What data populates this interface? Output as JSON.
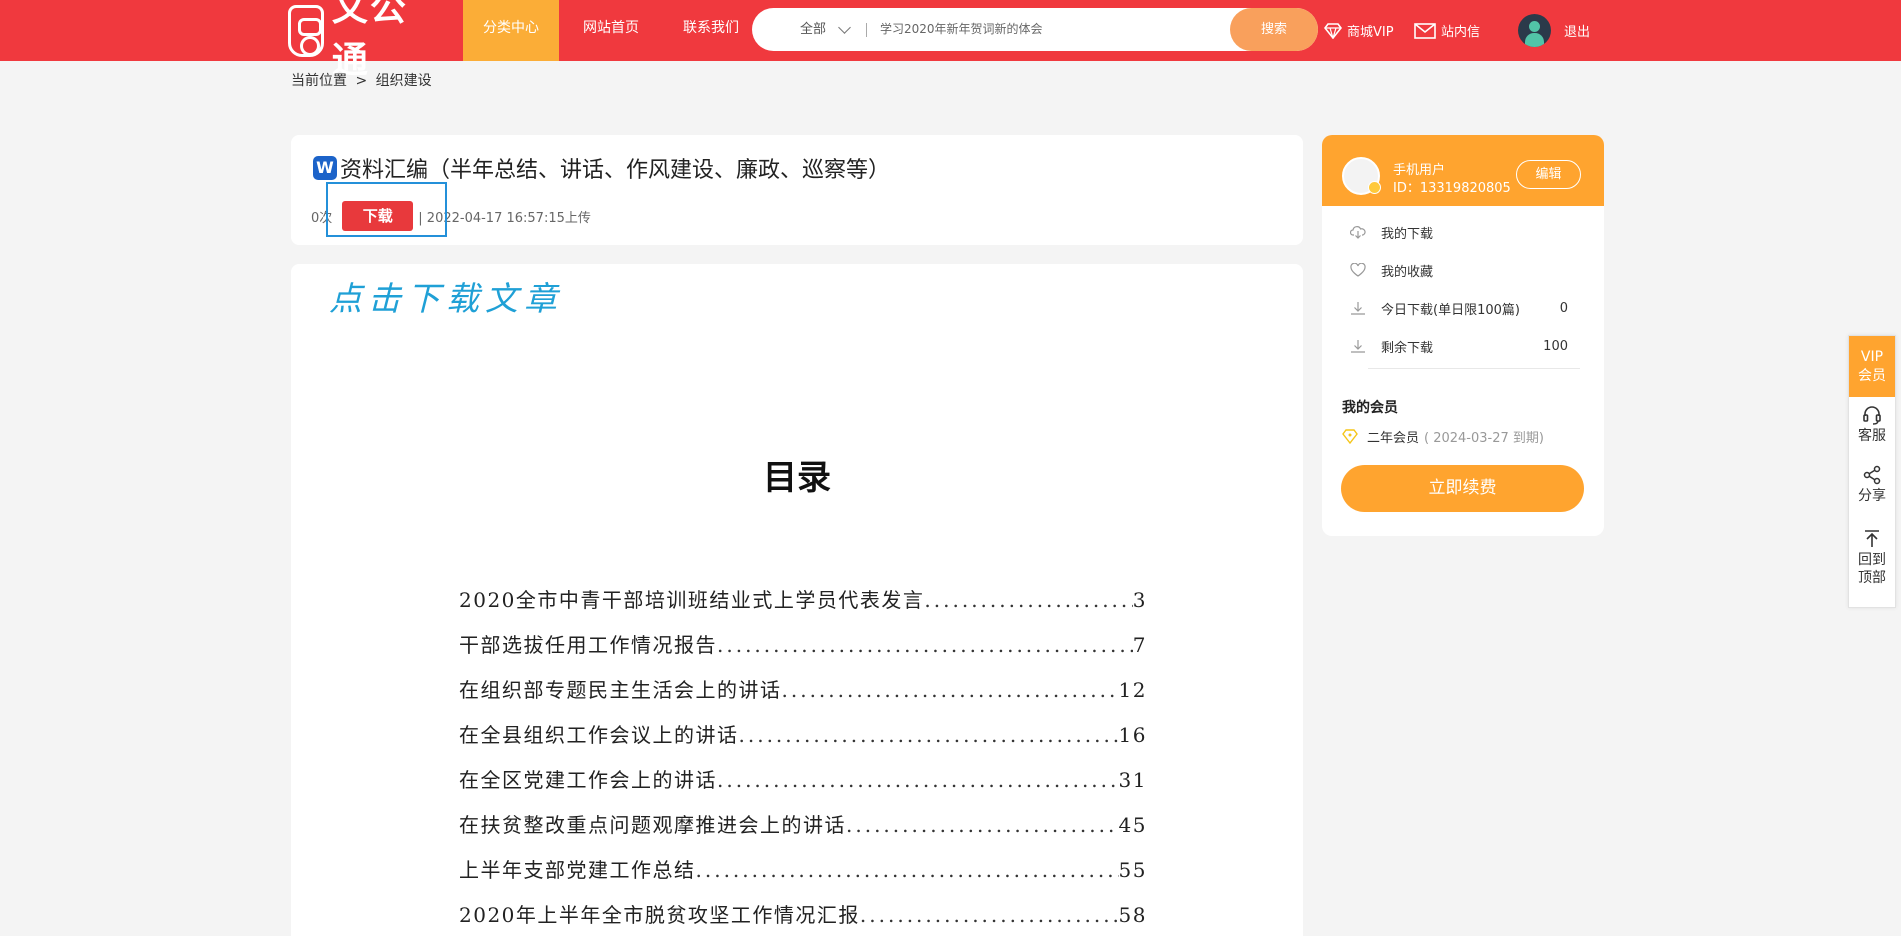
{
  "header": {
    "logo_text": "文公通",
    "nav": [
      "分类中心",
      "网站首页",
      "联系我们"
    ],
    "search": {
      "category": "全部",
      "placeholder": "学习2020年新年贺词新的体会",
      "button": "搜索"
    },
    "vip_link": "商城VIP",
    "mail_link": "站内信",
    "logout": "退出"
  },
  "breadcrumb": {
    "label": "当前位置",
    "sep": ">",
    "current": "组织建设"
  },
  "document": {
    "title": "资料汇编（半年总结、讲话、作风建设、廉政、巡察等）",
    "views": "0次",
    "download_label": "下载",
    "upload_info": "| 2022-04-17 16:57:15上传",
    "click_hint": "点击下载文章",
    "toc_title": "目录",
    "toc": [
      {
        "title": "2020全市中青干部培训班结业式上学员代表发言",
        "page": "3"
      },
      {
        "title": "干部选拔任用工作情况报告",
        "page": "7"
      },
      {
        "title": "在组织部专题民主生活会上的讲话",
        "page": "12"
      },
      {
        "title": "在全县组织工作会议上的讲话",
        "page": "16"
      },
      {
        "title": "在全区党建工作会上的讲话",
        "page": "31"
      },
      {
        "title": "在扶贫整改重点问题观摩推进会上的讲话",
        "page": "45"
      },
      {
        "title": "上半年支部党建工作总结",
        "page": "55"
      },
      {
        "title": "2020年上半年全市脱贫攻坚工作情况汇报",
        "page": "58"
      }
    ]
  },
  "user": {
    "name": "手机用户",
    "id": "ID：13319820805",
    "edit": "编辑",
    "menu": {
      "my_downloads": "我的下载",
      "my_favorites": "我的收藏",
      "today_label": "今日下载(单日限100篇)",
      "today_value": "0",
      "remaining_label": "剩余下载",
      "remaining_value": "100"
    },
    "membership_title": "我的会员",
    "membership": "二年会员",
    "expiry": "( 2024-03-27 到期)",
    "renew": "立即续费"
  },
  "sidebar": {
    "vip_line1": "VIP",
    "vip_line2": "会员",
    "service": "客服",
    "share": "分享",
    "top_line1": "回到",
    "top_line2": "顶部"
  },
  "colors": {
    "header_red": "#f0393e",
    "accent_orange": "#ffa42f",
    "download_red": "#e8393c",
    "hint_blue": "#1fa0d6"
  }
}
